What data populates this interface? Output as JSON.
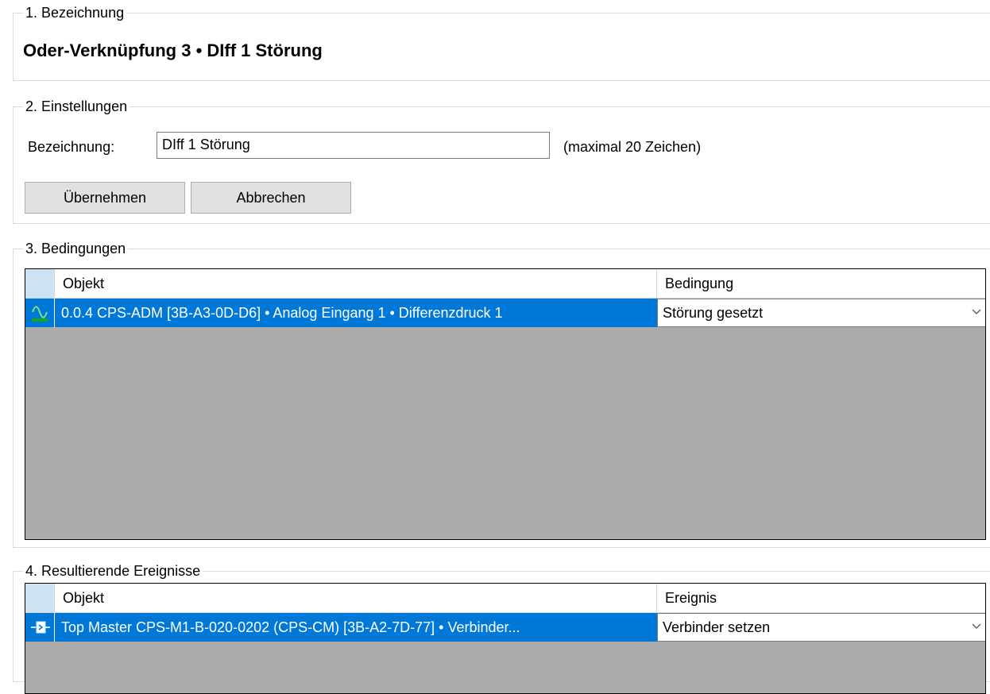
{
  "section1": {
    "legend": "1. Bezeichnung",
    "title": "Oder-Verknüpfung 3 • DIff 1 Störung"
  },
  "section2": {
    "legend": "2. Einstellungen",
    "name_label": "Bezeichnung:",
    "name_value": "DIff 1 Störung",
    "hint": "(maximal 20 Zeichen)",
    "apply_label": "Übernehmen",
    "cancel_label": "Abbrechen"
  },
  "section3": {
    "legend": "3. Bedingungen",
    "col_object": "Objekt",
    "col_condition": "Bedingung",
    "rows": [
      {
        "icon": "analog-signal-icon",
        "object": "0.0.4 CPS-ADM [3B-A3-0D-D6] • Analog Eingang 1 • Differenzdruck 1",
        "condition": "Störung gesetzt"
      }
    ]
  },
  "section4": {
    "legend": "4. Resultierende Ereignisse",
    "col_object": "Objekt",
    "col_event": "Ereignis",
    "rows": [
      {
        "icon": "connector-icon",
        "object": "Top Master CPS-M1-B-020-0202 (CPS-CM) [3B-A2-7D-77] • Verbinder...",
        "event": "Verbinder setzen"
      }
    ]
  },
  "colors": {
    "selection": "#0078d7",
    "grid_background": "#ababab",
    "row_header": "#cce2f5",
    "button": "#e1e1e1"
  }
}
